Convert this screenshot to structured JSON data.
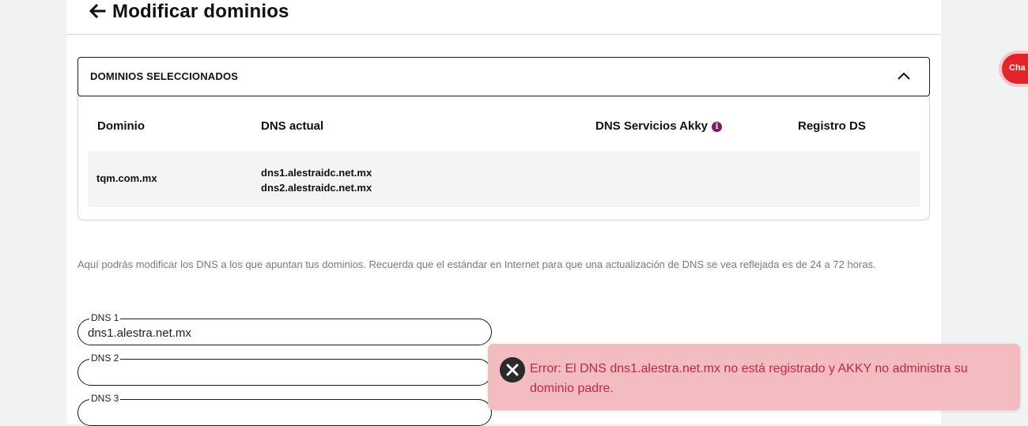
{
  "header": {
    "title": "Modificar dominios",
    "back_icon": "arrow-left-icon"
  },
  "accordion": {
    "title": "DOMINIOS SELECCIONADOS",
    "toggle_icon": "chevron-up-icon",
    "columns": {
      "domain": "Dominio",
      "dns_current": "DNS actual",
      "dns_akky": "DNS Servicios Akky",
      "registro_ds": "Registro DS"
    },
    "info_icon": "info-icon",
    "rows": [
      {
        "domain": "tqm.com.mx",
        "dns1": "dns1.alestraidc.net.mx",
        "dns2": "dns2.alestraidc.net.mx"
      }
    ]
  },
  "description": "Aquí podrás modificar los DNS a los que apuntan tus dominios. Recuerda que el estándar en Internet para que una actualización de DNS se vea reflejada es de 24 a 72 horas.",
  "dns_fields": [
    {
      "label": "DNS 1",
      "value": "dns1.alestra.net.mx"
    },
    {
      "label": "DNS 2",
      "value": ""
    },
    {
      "label": "DNS 3",
      "value": ""
    }
  ],
  "toast": {
    "message": "Error: El DNS dns1.alestra.net.mx no está registrado y AKKY no administra su dominio padre.",
    "close_icon": "close-icon",
    "background": "#f2bcc1",
    "text_color": "#c0293f"
  },
  "chat": {
    "label": "Cha"
  },
  "colors": {
    "accent": "#7a1d6e",
    "chat_red": "#e3242b"
  }
}
